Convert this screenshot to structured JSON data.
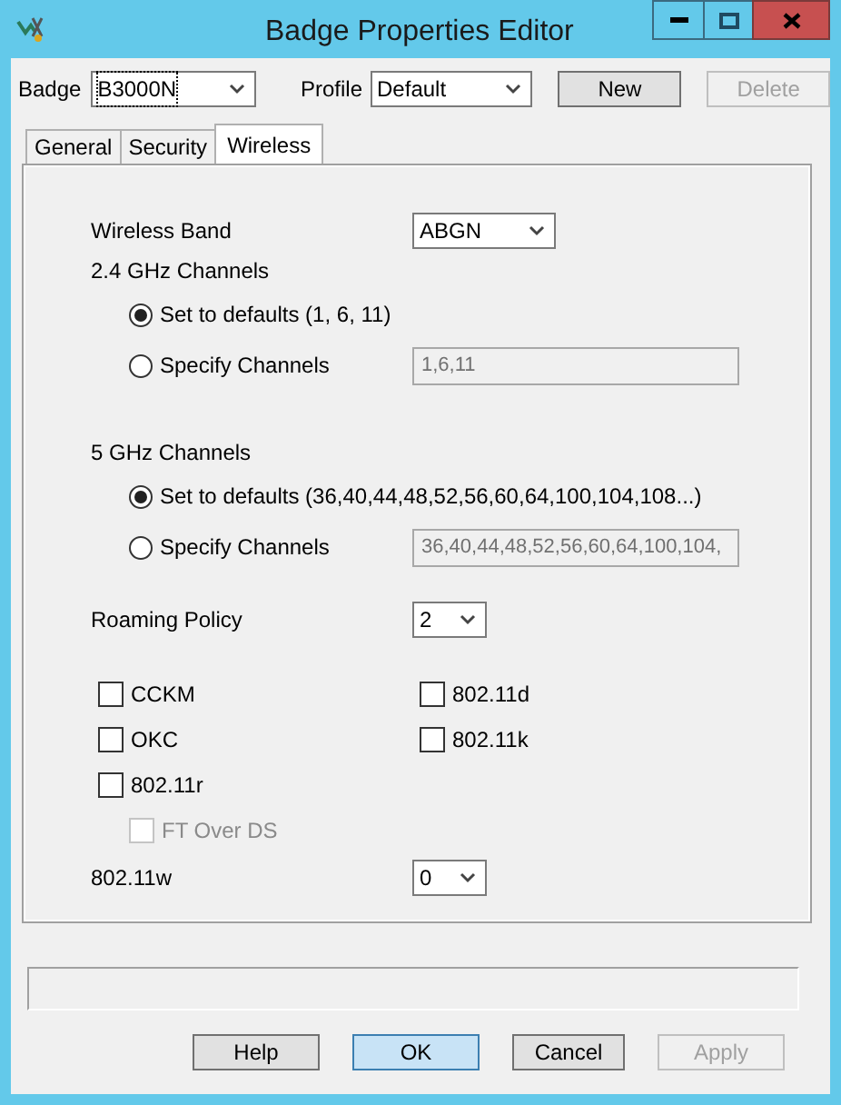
{
  "window": {
    "title": "Badge Properties Editor"
  },
  "header": {
    "badge_label": "Badge",
    "badge_value": "B3000N",
    "profile_label": "Profile",
    "profile_value": "Default",
    "buttons": [
      {
        "label": "New",
        "disabled": false
      },
      {
        "label": "Delete",
        "disabled": true
      }
    ]
  },
  "tabs": [
    {
      "label": "General",
      "selected": false
    },
    {
      "label": "Security",
      "selected": false
    },
    {
      "label": "Wireless",
      "selected": true
    }
  ],
  "wireless_band": {
    "label": "Wireless Band",
    "value": "ABGN"
  },
  "channel_groups": [
    {
      "title": "2.4 GHz Channels",
      "options": [
        {
          "label": "Set to defaults (1, 6, 11)",
          "selected": true
        },
        {
          "label": "Specify Channels",
          "selected": false
        }
      ],
      "field": {
        "value": "1,6,11",
        "disabled": true
      }
    },
    {
      "title": "5 GHz Channels",
      "options": [
        {
          "label": "Set to defaults (36,40,44,48,52,56,60,64,100,104,108...)",
          "selected": true
        },
        {
          "label": "Specify Channels",
          "selected": false
        }
      ],
      "field": {
        "value": "36,40,44,48,52,56,60,64,100,104,",
        "disabled": true
      }
    }
  ],
  "roaming_policy": {
    "label": "Roaming Policy",
    "value": "2"
  },
  "left_options": [
    {
      "label": "CCKM",
      "checked": false,
      "disabled": false
    },
    {
      "label": "OKC",
      "checked": false,
      "disabled": false
    },
    {
      "label": "802.11r",
      "checked": false,
      "disabled": false,
      "children": [
        {
          "label": "FT Over DS",
          "checked": false,
          "disabled": true
        }
      ]
    }
  ],
  "right_options": [
    {
      "label": "802.11d",
      "checked": false,
      "disabled": false
    },
    {
      "label": "802.11k",
      "checked": false,
      "disabled": false
    }
  ],
  "pmf": {
    "label": "802.11w",
    "value": "0"
  },
  "buttons": [
    {
      "label": "Help",
      "disabled": false,
      "default": false
    },
    {
      "label": "OK",
      "disabled": false,
      "default": true
    },
    {
      "label": "Cancel",
      "disabled": false,
      "default": false
    },
    {
      "label": "Apply",
      "disabled": true,
      "default": false
    }
  ]
}
